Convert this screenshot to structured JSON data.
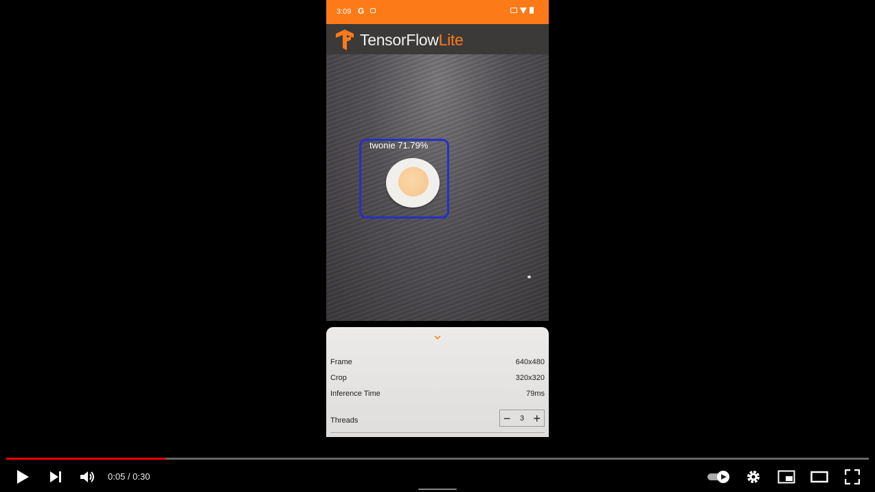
{
  "status_bar": {
    "time": "3:09",
    "google_glyph": "G"
  },
  "app": {
    "title_main": "TensorFlow",
    "title_accent": "Lite",
    "accent_color": "#fd7a19"
  },
  "detection": {
    "label": "twonie 71.79%",
    "box_color": "#2430c7"
  },
  "bottom_sheet": {
    "rows": [
      {
        "label": "Frame",
        "value": "640x480"
      },
      {
        "label": "Crop",
        "value": "320x320"
      },
      {
        "label": "Inference Time",
        "value": "79ms"
      }
    ],
    "threads": {
      "label": "Threads",
      "value": "3",
      "minus": "−",
      "plus": "+"
    }
  },
  "player": {
    "current_time": "0:05",
    "duration": "0:30",
    "time_text": "0:05 / 0:30",
    "progress_fraction": 0.1846,
    "progress_color": "#ff0000",
    "icons": [
      "play-icon",
      "next-icon",
      "volume-icon",
      "autoplay-toggle-icon",
      "settings-icon",
      "miniplayer-icon",
      "theater-icon",
      "fullscreen-icon"
    ]
  }
}
